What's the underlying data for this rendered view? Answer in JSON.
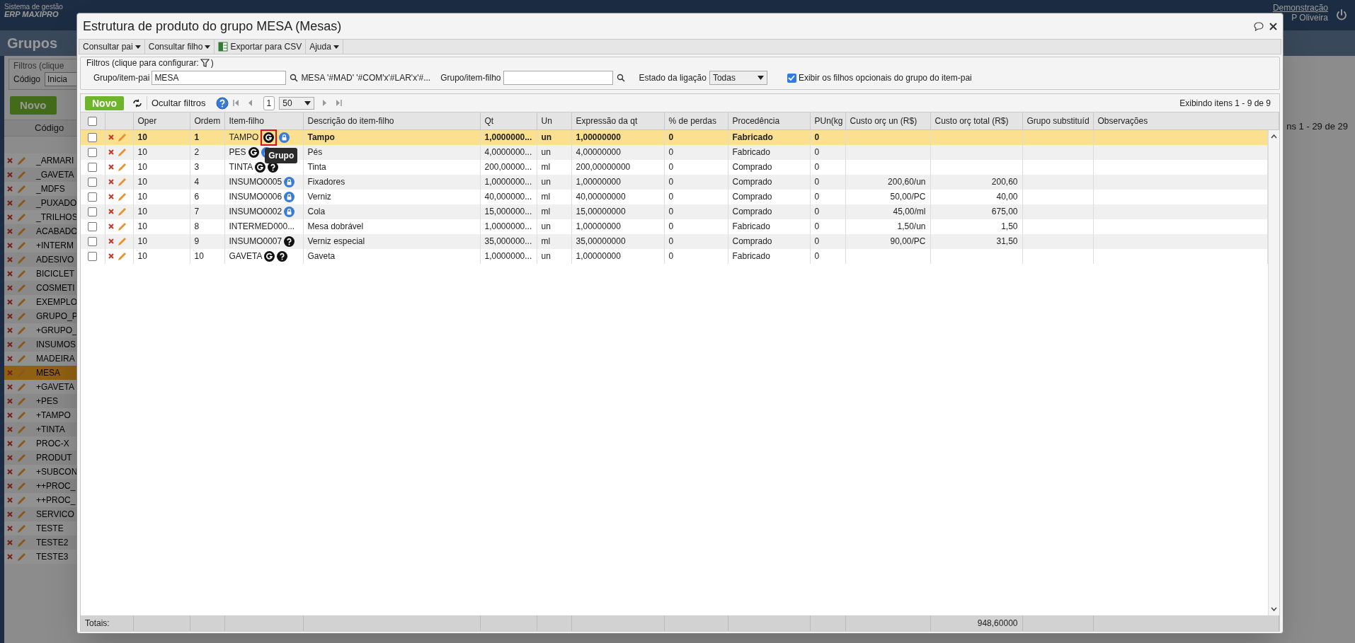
{
  "background": {
    "brand": [
      "Sistema de gestão",
      "ERP MAXIPRO"
    ],
    "company": "Demonstração",
    "user": "P Oliveira",
    "page_title": "Grupos",
    "filters_legend": "Filtros (clique",
    "code_label": "Código",
    "code_filter": "Inicia",
    "new_button": "Novo",
    "column": "Código",
    "summary": "ns 1 - 29 de 29",
    "items": [
      {
        "code": "_ARMARI",
        "selected": false
      },
      {
        "code": "_GAVETA",
        "selected": false
      },
      {
        "code": "_MDFS",
        "selected": false
      },
      {
        "code": "_PUXADO",
        "selected": false
      },
      {
        "code": "_TRILHOS",
        "selected": false
      },
      {
        "code": "ACABADO",
        "selected": false
      },
      {
        "code": "+INTERM",
        "selected": false
      },
      {
        "code": "ADESIVO",
        "selected": false
      },
      {
        "code": "BICICLET",
        "selected": false
      },
      {
        "code": "COSMETI",
        "selected": false
      },
      {
        "code": "EXEMPLO",
        "selected": false
      },
      {
        "code": "GRUPO_P",
        "selected": false
      },
      {
        "code": "+GRUPO_",
        "selected": false
      },
      {
        "code": "INSUMOS",
        "selected": false
      },
      {
        "code": "MADEIRA",
        "selected": false
      },
      {
        "code": "MESA",
        "selected": true
      },
      {
        "code": "+GAVETA",
        "selected": false
      },
      {
        "code": "+PES",
        "selected": false
      },
      {
        "code": "+TAMPO",
        "selected": false
      },
      {
        "code": "+TINTA",
        "selected": false
      },
      {
        "code": "PROC-X",
        "selected": false
      },
      {
        "code": "PRODUT",
        "selected": false
      },
      {
        "code": "+SUBCON",
        "selected": false
      },
      {
        "code": "++PROC_",
        "selected": false
      },
      {
        "code": "++PROC_",
        "selected": false
      },
      {
        "code": "SERVICO",
        "selected": false
      },
      {
        "code": "TESTE",
        "selected": false
      },
      {
        "code": "TESTE2",
        "selected": false
      },
      {
        "code": "TESTE3",
        "selected": false
      }
    ]
  },
  "dialog": {
    "title": "Estrutura de produto do grupo MESA (Mesas)",
    "toolbar": [
      {
        "label": "Consultar pai",
        "kind": "menu"
      },
      {
        "label": "Consultar filho",
        "kind": "menu"
      },
      {
        "label": "Exportar para CSV",
        "kind": "export"
      },
      {
        "label": "Ajuda",
        "kind": "menu"
      }
    ],
    "filters": {
      "legend_start": "Filtros (clique para configurar:",
      "legend_end": ")",
      "parent_label": "Grupo/item-pai",
      "parent_value": "MESA",
      "parent_description": "MESA '#MAD' '#COM'x'#LAR'x'#...",
      "child_label": "Grupo/item-filho",
      "state_label": "Estado da ligação",
      "state_value": "Todas",
      "optional": {
        "label": "Exibir os filhos opcionais do grupo do item-pai",
        "checked": true
      }
    },
    "grid": {
      "new_button": "Novo",
      "hide_filters": "Ocultar filtros",
      "page": "1",
      "page_size": "50",
      "summary": "Exibindo itens 1 - 9 de 9",
      "select_all": {
        "checked": false
      },
      "columns": [
        "Oper",
        "Ordem",
        "Item-filho",
        "Descrição do item-filho",
        "Qt",
        "Un",
        "Expressão da qt",
        "% de perdas",
        "Procedência",
        "PUn(kg",
        "Custo orç un (R$)",
        "Custo orç total (R$)",
        "Grupo substituíd",
        "Observações"
      ],
      "rows": [
        {
          "selected": true,
          "checked": false,
          "oper": "10",
          "order": "1",
          "item": "TAMPO",
          "icons": [
            {
              "kind": "group",
              "highlighted": true,
              "tooltip": "Grupo"
            },
            {
              "kind": "locked",
              "highlighted": false
            }
          ],
          "description": "Tampo",
          "qt": "1,0000000...",
          "un": "un",
          "expression": "1,00000000",
          "losses": "0",
          "origin": "Fabricado",
          "weight": "0"
        },
        {
          "selected": false,
          "checked": false,
          "oper": "10",
          "order": "2",
          "item": "PES",
          "icons": [
            {
              "kind": "group",
              "highlighted": false
            },
            {
              "kind": "locked",
              "highlighted": false
            }
          ],
          "description": "Pés",
          "qt": "4,0000000...",
          "un": "un",
          "expression": "4,00000000",
          "losses": "0",
          "origin": "Fabricado",
          "weight": "0"
        },
        {
          "selected": false,
          "checked": false,
          "oper": "10",
          "order": "3",
          "item": "TINTA",
          "icons": [
            {
              "kind": "group",
              "highlighted": false
            },
            {
              "kind": "unknown",
              "highlighted": false
            }
          ],
          "description": "Tinta",
          "qt": "200,00000...",
          "un": "ml",
          "expression": "200,00000000",
          "losses": "0",
          "origin": "Comprado",
          "weight": "0"
        },
        {
          "selected": false,
          "checked": false,
          "oper": "10",
          "order": "4",
          "item": "INSUMO0005",
          "icons": [
            {
              "kind": "locked",
              "highlighted": false
            }
          ],
          "description": "Fixadores",
          "qt": "1,0000000...",
          "un": "un",
          "expression": "1,00000000",
          "losses": "0",
          "origin": "Comprado",
          "weight": "0",
          "unit_cost": "200,60/un",
          "total_cost": "200,60"
        },
        {
          "selected": false,
          "checked": false,
          "oper": "10",
          "order": "6",
          "item": "INSUMO0006",
          "icons": [
            {
              "kind": "locked",
              "highlighted": false
            }
          ],
          "description": "Verniz",
          "qt": "40,000000...",
          "un": "ml",
          "expression": "40,00000000",
          "losses": "0",
          "origin": "Comprado",
          "weight": "0",
          "unit_cost": "50,00/PC",
          "total_cost": "40,00"
        },
        {
          "selected": false,
          "checked": false,
          "oper": "10",
          "order": "7",
          "item": "INSUMO0002",
          "icons": [
            {
              "kind": "locked",
              "highlighted": false
            }
          ],
          "description": "Cola",
          "qt": "15,000000...",
          "un": "ml",
          "expression": "15,00000000",
          "losses": "0",
          "origin": "Comprado",
          "weight": "0",
          "unit_cost": "45,00/ml",
          "total_cost": "675,00"
        },
        {
          "selected": false,
          "checked": false,
          "oper": "10",
          "order": "8",
          "item": "INTERMED000...",
          "icons": [],
          "description": "Mesa dobrável",
          "qt": "1,0000000...",
          "un": "un",
          "expression": "1,00000000",
          "losses": "0",
          "origin": "Fabricado",
          "weight": "0",
          "unit_cost": "1,50/un",
          "total_cost": "1,50"
        },
        {
          "selected": false,
          "checked": false,
          "oper": "10",
          "order": "9",
          "item": "INSUMO0007",
          "icons": [
            {
              "kind": "unknown",
              "highlighted": false
            }
          ],
          "description": "Verniz especial",
          "qt": "35,000000...",
          "un": "ml",
          "expression": "35,00000000",
          "losses": "0",
          "origin": "Comprado",
          "weight": "0",
          "unit_cost": "90,00/PC",
          "total_cost": "31,50"
        },
        {
          "selected": false,
          "checked": false,
          "oper": "10",
          "order": "10",
          "item": "GAVETA",
          "icons": [
            {
              "kind": "group",
              "highlighted": false
            },
            {
              "kind": "unknown",
              "highlighted": false
            }
          ],
          "description": "Gaveta",
          "qt": "1,0000000...",
          "un": "un",
          "expression": "1,00000000",
          "losses": "0",
          "origin": "Fabricado",
          "weight": "0"
        }
      ],
      "totals": {
        "label": "Totais:",
        "total_cost": "948,60000"
      }
    }
  }
}
